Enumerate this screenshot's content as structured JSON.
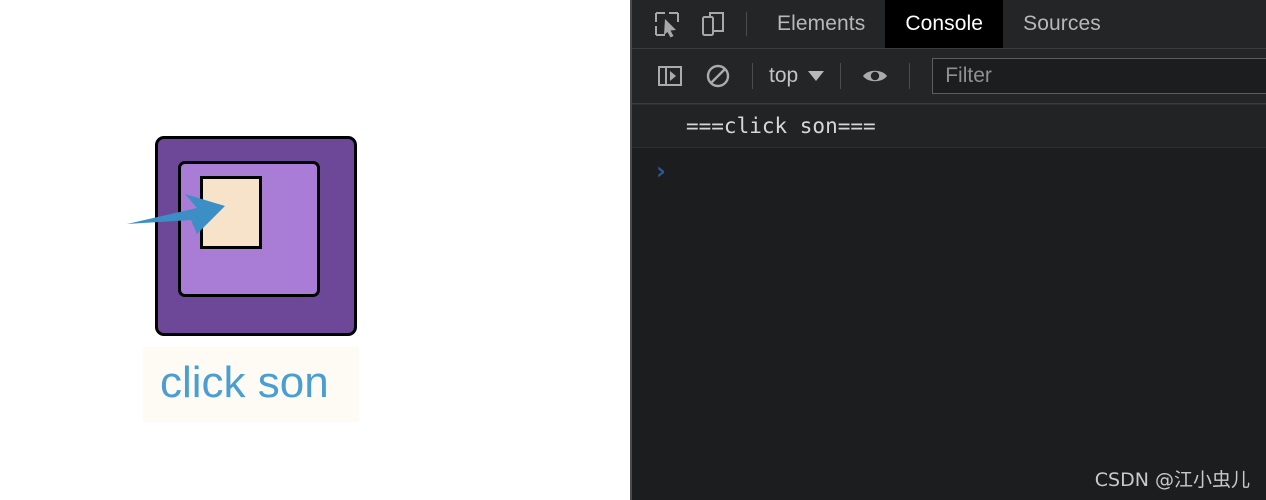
{
  "page": {
    "box_outer_name": "parent-box",
    "box_middle_name": "child-box",
    "box_inner_name": "son-box",
    "button_label": "click son",
    "arrow_color": "#3b8fc4",
    "colors": {
      "outer_box": "#6e4898",
      "middle_box": "#a97dd6",
      "inner_box": "#f6e3c9",
      "label_text": "#4a9ed2",
      "label_bg": "#fdfbf4",
      "border": "#000000"
    }
  },
  "devtools": {
    "tabs": [
      {
        "label": "Elements",
        "active": false
      },
      {
        "label": "Console",
        "active": true
      },
      {
        "label": "Sources",
        "active": false
      }
    ],
    "tabbar_icons": [
      {
        "name": "inspect-element-icon"
      },
      {
        "name": "device-toolbar-icon"
      }
    ],
    "toolbar": {
      "sidebar_toggle_icon": "console-sidebar-icon",
      "clear_console_icon": "clear-console-icon",
      "context_value": "top",
      "context_caret": "▼",
      "eye_icon": "live-expression-eye-icon",
      "filter_placeholder": "Filter"
    },
    "console": {
      "messages": [
        {
          "text": "===click son===",
          "level": "log"
        }
      ],
      "prompt_symbol": "›"
    },
    "colors": {
      "panel_bg": "#1b1d1f",
      "toolbar_bg": "#242526",
      "active_tab_bg": "#000000",
      "message_bg": "#212325",
      "prompt_blue": "#2b5797"
    }
  },
  "watermark": {
    "text": "CSDN @江小虫儿"
  }
}
